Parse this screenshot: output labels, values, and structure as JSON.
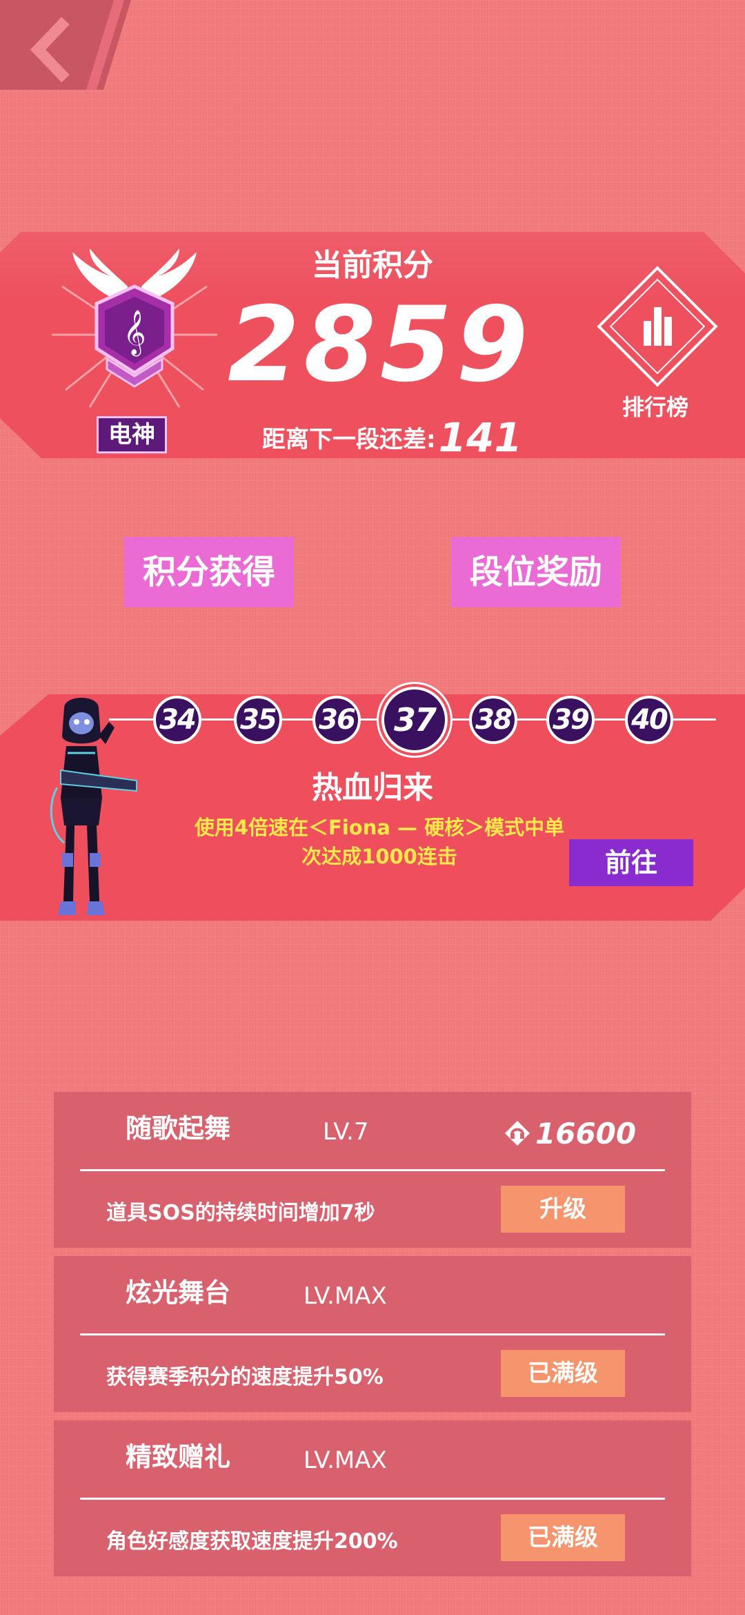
{
  "score": {
    "label": "当前积分",
    "value": "2859",
    "next_text": "距离下一段还差:",
    "next_value": "141",
    "rank_name": "电神",
    "leaderboard_label": "排行榜"
  },
  "buttons": {
    "points": "积分获得",
    "rewards": "段位奖励"
  },
  "levels": {
    "items": [
      "34",
      "35",
      "36",
      "37",
      "38",
      "39",
      "40"
    ],
    "current": "37"
  },
  "task": {
    "title": "热血归来",
    "desc_line1": "使用4倍速在＜Fiona — 硬核＞模式中单",
    "desc_line2": "次达成1000连击",
    "go_label": "前往"
  },
  "upgrades": [
    {
      "name": "随歌起舞",
      "level": "LV.7",
      "cost": "16600",
      "desc": "道具SOS的持续时间增加7秒",
      "action": "升级"
    },
    {
      "name": "炫光舞台",
      "level": "LV.MAX",
      "desc": "获得赛季积分的速度提升50%",
      "action": "已满级"
    },
    {
      "name": "精致赠礼",
      "level": "LV.MAX",
      "desc": "角色好感度获取速度提升200%",
      "action": "已满级"
    }
  ],
  "colors": {
    "background": "#f07a7c",
    "panel": "#ee505e",
    "pink_button": "#e96bd3",
    "go_button": "#8a2bd0",
    "orange_button": "#f5946d",
    "task_text": "#ffe84a"
  }
}
